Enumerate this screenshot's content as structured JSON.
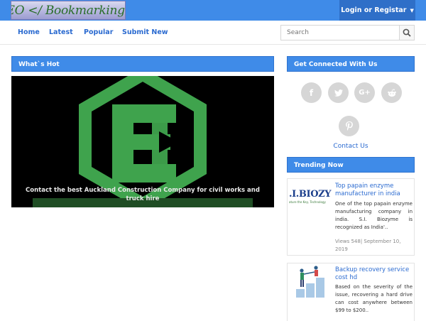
{
  "header": {
    "logo_text": "SEO </ Bookmarking >",
    "login_label": "Login or Registar"
  },
  "nav": {
    "items": [
      {
        "label": "Home"
      },
      {
        "label": "Latest"
      },
      {
        "label": "Popular"
      },
      {
        "label": "Submit New"
      }
    ]
  },
  "search": {
    "placeholder": "Search",
    "value": ""
  },
  "hot": {
    "title": "What`s Hot",
    "caption": "Contact the best Auckland Construction Company for civil works and truck hire"
  },
  "connect": {
    "title": "Get Connected With Us",
    "icons": [
      "facebook-icon",
      "twitter-icon",
      "google-plus-icon",
      "reddit-icon",
      "pinterest-icon"
    ],
    "contact_label": "Contact Us"
  },
  "trending": {
    "title": "Trending Now",
    "items": [
      {
        "thumb_text": ".I.BIOZY",
        "thumb_sub": "ature the Key, Technology",
        "title": "Top papain enzyme manufacturer in india",
        "description": "One of the top papain enzyme manufacturing company in india. S.I. Biozyme is recognized as India'..",
        "meta": "Views 548| September 10, 2019"
      },
      {
        "title": "Backup recovery service cost hd",
        "description": "Based on the severity of the issue, recovering a hard drive can cost anywhere between $99 to $200.."
      }
    ]
  },
  "colors": {
    "primary": "#3f8be8",
    "link": "#2a6ad0",
    "login_bg": "#2f6fc8",
    "social_bg": "#d6d6d6"
  }
}
